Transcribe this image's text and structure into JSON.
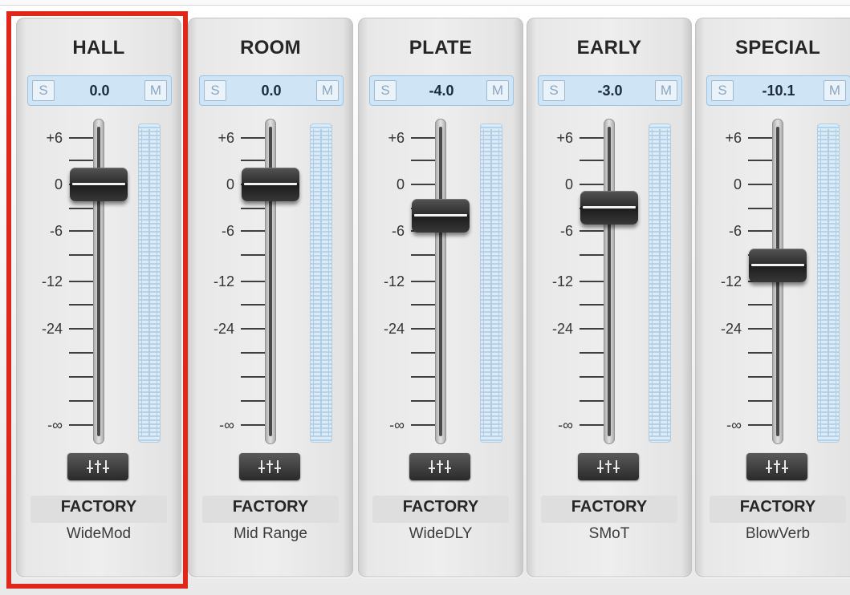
{
  "channels": [
    {
      "name": "HALL",
      "value": "0.0",
      "solo": "S",
      "mute": "M",
      "level_db": 0.0,
      "preset_type": "FACTORY",
      "preset_name": "WideMod",
      "selected": true
    },
    {
      "name": "ROOM",
      "value": "0.0",
      "solo": "S",
      "mute": "M",
      "level_db": 0.0,
      "preset_type": "FACTORY",
      "preset_name": "Mid Range",
      "selected": false
    },
    {
      "name": "PLATE",
      "value": "-4.0",
      "solo": "S",
      "mute": "M",
      "level_db": -4.0,
      "preset_type": "FACTORY",
      "preset_name": "WideDLY",
      "selected": false
    },
    {
      "name": "EARLY",
      "value": "-3.0",
      "solo": "S",
      "mute": "M",
      "level_db": -3.0,
      "preset_type": "FACTORY",
      "preset_name": "SMoT",
      "selected": false
    },
    {
      "name": "SPECIAL",
      "value": "-10.1",
      "solo": "S",
      "mute": "M",
      "level_db": -10.1,
      "preset_type": "FACTORY",
      "preset_name": "BlowVerb",
      "selected": false
    }
  ],
  "scale_labels": [
    "+6",
    "0",
    "-6",
    "-12",
    "-24",
    "-∞"
  ],
  "colors": {
    "highlight": "#e0281a",
    "meter": "#dcecf6",
    "fader_cap": "#2e2e2e"
  },
  "icons": {
    "edit_button": "mixer-sliders-icon"
  }
}
